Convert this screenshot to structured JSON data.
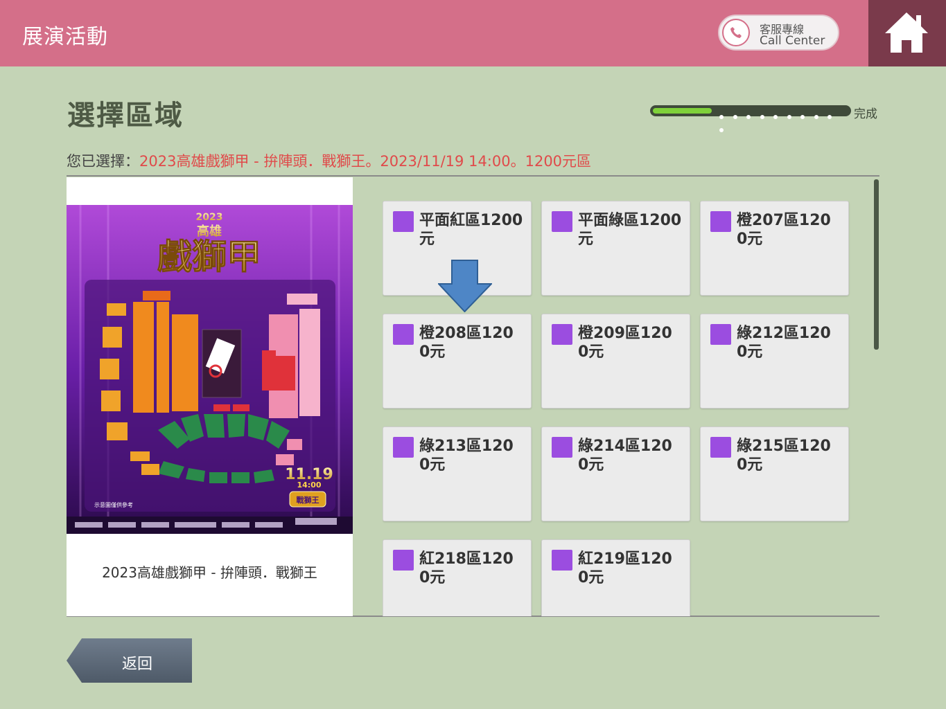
{
  "header": {
    "title": "展演活動",
    "call_center_zh": "客服專線",
    "call_center_en": "Call Center"
  },
  "page": {
    "title": "選擇區域",
    "progress_label": "完成",
    "progress_fraction": 0.3
  },
  "selection": {
    "prefix": "您已選擇：",
    "value": "2023高雄戲獅甲 - 拚陣頭．戰獅王。2023/11/19 14:00。1200元區"
  },
  "event": {
    "name": "2023高雄戲獅甲 - 拚陣頭．戰獅王",
    "poster": {
      "year": "2023",
      "city": "高雄",
      "title": "戲獅甲",
      "date": "11.19",
      "time": "14:00",
      "badge": "戰獅王",
      "note": "示意圖僅供參考"
    }
  },
  "zones": [
    {
      "label": "平面紅區1200元",
      "color": "#9b4de0"
    },
    {
      "label": "平面綠區1200元",
      "color": "#9b4de0"
    },
    {
      "label": "橙207區1200元",
      "color": "#9b4de0"
    },
    {
      "label": "橙208區1200元",
      "color": "#9b4de0"
    },
    {
      "label": "橙209區1200元",
      "color": "#9b4de0"
    },
    {
      "label": "綠212區1200元",
      "color": "#9b4de0"
    },
    {
      "label": "綠213區1200元",
      "color": "#9b4de0"
    },
    {
      "label": "綠214區1200元",
      "color": "#9b4de0"
    },
    {
      "label": "綠215區1200元",
      "color": "#9b4de0"
    },
    {
      "label": "紅218區1200元",
      "color": "#9b4de0"
    },
    {
      "label": "紅219區1200元",
      "color": "#9b4de0"
    }
  ],
  "footer": {
    "back_label": "返回"
  }
}
